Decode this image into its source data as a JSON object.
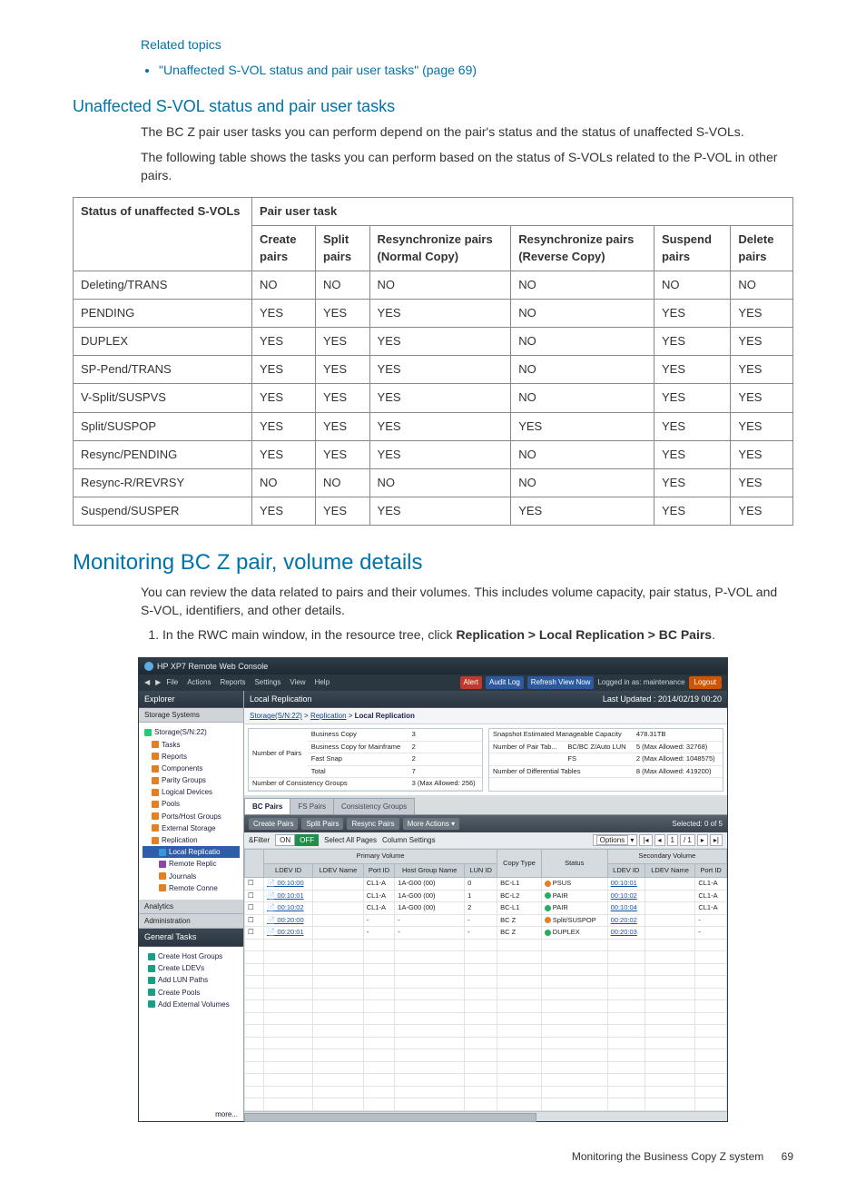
{
  "related": {
    "heading": "Related topics",
    "items": [
      "\"Unaffected S-VOL status and pair user tasks\" (page 69)"
    ]
  },
  "section1": {
    "title": "Unaffected S-VOL status and pair user tasks",
    "p1": "The BC Z pair user tasks you can perform depend on the pair's status and the status of unaffected S-VOLs.",
    "p2": "The following table shows the tasks you can perform based on the status of S-VOLs related to the P-VOL in other pairs."
  },
  "table": {
    "h_status": "Status of unaffected S-VOLs",
    "h_pair": "Pair user task",
    "cols": [
      "Create pairs",
      "Split pairs",
      "Resynchronize pairs (Normal Copy)",
      "Resynchronize pairs (Reverse Copy)",
      "Suspend pairs",
      "Delete pairs"
    ],
    "rows": [
      {
        "s": "Deleting/TRANS",
        "v": [
          "NO",
          "NO",
          "NO",
          "NO",
          "NO",
          "NO"
        ]
      },
      {
        "s": "PENDING",
        "v": [
          "YES",
          "YES",
          "YES",
          "NO",
          "YES",
          "YES"
        ]
      },
      {
        "s": "DUPLEX",
        "v": [
          "YES",
          "YES",
          "YES",
          "NO",
          "YES",
          "YES"
        ]
      },
      {
        "s": "SP-Pend/TRANS",
        "v": [
          "YES",
          "YES",
          "YES",
          "NO",
          "YES",
          "YES"
        ]
      },
      {
        "s": "V-Split/SUSPVS",
        "v": [
          "YES",
          "YES",
          "YES",
          "NO",
          "YES",
          "YES"
        ]
      },
      {
        "s": "Split/SUSPOP",
        "v": [
          "YES",
          "YES",
          "YES",
          "YES",
          "YES",
          "YES"
        ]
      },
      {
        "s": "Resync/PENDING",
        "v": [
          "YES",
          "YES",
          "YES",
          "NO",
          "YES",
          "YES"
        ]
      },
      {
        "s": "Resync-R/REVRSY",
        "v": [
          "NO",
          "NO",
          "NO",
          "NO",
          "YES",
          "YES"
        ]
      },
      {
        "s": "Suspend/SUSPER",
        "v": [
          "YES",
          "YES",
          "YES",
          "YES",
          "YES",
          "YES"
        ]
      }
    ]
  },
  "section2": {
    "title": "Monitoring BC Z pair, volume details",
    "p1": "You can review the data related to pairs and their volumes. This includes volume capacity, pair status, P-VOL and S-VOL, identifiers, and other details.",
    "step1_pre": "In the RWC main window, in the resource tree, click ",
    "step1_bold": "Replication > Local Replication > BC Pairs",
    "step1_post": "."
  },
  "screenshot": {
    "title": "HP XP7 Remote Web Console",
    "menu": {
      "nav": [
        "File",
        "Actions",
        "Reports",
        "Settings",
        "View",
        "Help"
      ]
    },
    "status": {
      "alert": "Alert",
      "audit": "Audit Log",
      "refresh": "Refresh View Now",
      "logged": "Logged in as: maintenance",
      "logout": "Logout"
    },
    "explorer": {
      "title": "Explorer",
      "storage": "Storage Systems",
      "tree": [
        "Storage(S/N:22)",
        "Tasks",
        "Reports",
        "Components",
        "Parity Groups",
        "Logical Devices",
        "Pools",
        "Ports/Host Groups",
        "External Storage",
        "Replication",
        "Local Replicatio",
        "Remote Replic",
        "Journals",
        "Remote Conne"
      ],
      "analytics": "Analytics",
      "admin": "Administration",
      "gentasks_title": "General Tasks",
      "gentasks": [
        "Create Host Groups",
        "Create LDEVs",
        "Add LUN Paths",
        "Create Pools",
        "Add External Volumes"
      ],
      "more": "more..."
    },
    "main": {
      "title": "Local Replication",
      "updated": "Last Updated : 2014/02/19 00:20",
      "breadcrumb": {
        "a": "Storage(S/N:22)",
        "b": "Replication",
        "c": "Local Replication"
      },
      "summary_left": {
        "npairs": "Number of Pairs",
        "bc": "Business Copy",
        "bcv": "3",
        "bcmf": "Business Copy for Mainframe",
        "bcmfv": "2",
        "fs": "Fast Snap",
        "fsv": "2",
        "tot": "Total",
        "totv": "7",
        "ncg": "Number of Consistency Groups",
        "ncgv": "3 (Max Allowed: 256)"
      },
      "summary_right": {
        "semc": "Snapshot Estimated Manageable Capacity",
        "semcv": "478.31TB",
        "npt": "Number of Pair Tab...",
        "nptl": "BC/BC Z/Auto LUN",
        "nptv": "5 (Max Allowed: 32768)",
        "fs": "FS",
        "fsv": "2 (Max Allowed: 1048575)",
        "ndt": "Number of Differential Tables",
        "ndtv": "8 (Max Allowed: 419200)"
      },
      "tabs": [
        "BC Pairs",
        "FS Pairs",
        "Consistency Groups"
      ],
      "actions": {
        "create": "Create Pairs",
        "split": "Split Pairs",
        "resync": "Resync Pairs",
        "more": "More Actions",
        "selected": "Selected: 0 of 5"
      },
      "filter": {
        "label": "&Filter",
        "on": "ON",
        "off": "OFF",
        "select": "Select All Pages",
        "col": "Column Settings",
        "opt": "Options",
        "page": "1",
        "total": "/ 1"
      },
      "pairhead": {
        "primary": "Primary Volume",
        "secondary": "Secondary Volume",
        "ldevid": "LDEV ID",
        "ldevname": "LDEV Name",
        "portid": "Port ID",
        "hg": "Host Group Name",
        "lun": "LUN ID",
        "ctype": "Copy Type",
        "status": "Status"
      },
      "rows": [
        {
          "p": "00:10:00",
          "port": "CL1-A",
          "hg": "1A-G00 (00)",
          "lun": "0",
          "ct": "BC-L1",
          "st": "PSUS",
          "sec": "00:10:01",
          "sport": "CL1-A"
        },
        {
          "p": "00:10:01",
          "port": "CL1-A",
          "hg": "1A-G00 (00)",
          "lun": "1",
          "ct": "BC-L2",
          "st": "PAIR",
          "sec": "00:10:02",
          "sport": "CL1-A"
        },
        {
          "p": "00:10:02",
          "port": "CL1-A",
          "hg": "1A-G00 (00)",
          "lun": "2",
          "ct": "BC-L1",
          "st": "PAIR",
          "sec": "00:10:04",
          "sport": "CL1-A"
        },
        {
          "p": "00:20:00",
          "port": "-",
          "hg": "-",
          "lun": "-",
          "ct": "BC Z",
          "st": "Split/SUSPOP",
          "sec": "00:20:02",
          "sport": "-"
        },
        {
          "p": "00:20:01",
          "port": "-",
          "hg": "-",
          "lun": "-",
          "ct": "BC Z",
          "st": "DUPLEX",
          "sec": "00:20:03",
          "sport": "-"
        }
      ]
    }
  },
  "footer": {
    "text": "Monitoring the Business Copy Z system",
    "page": "69"
  }
}
